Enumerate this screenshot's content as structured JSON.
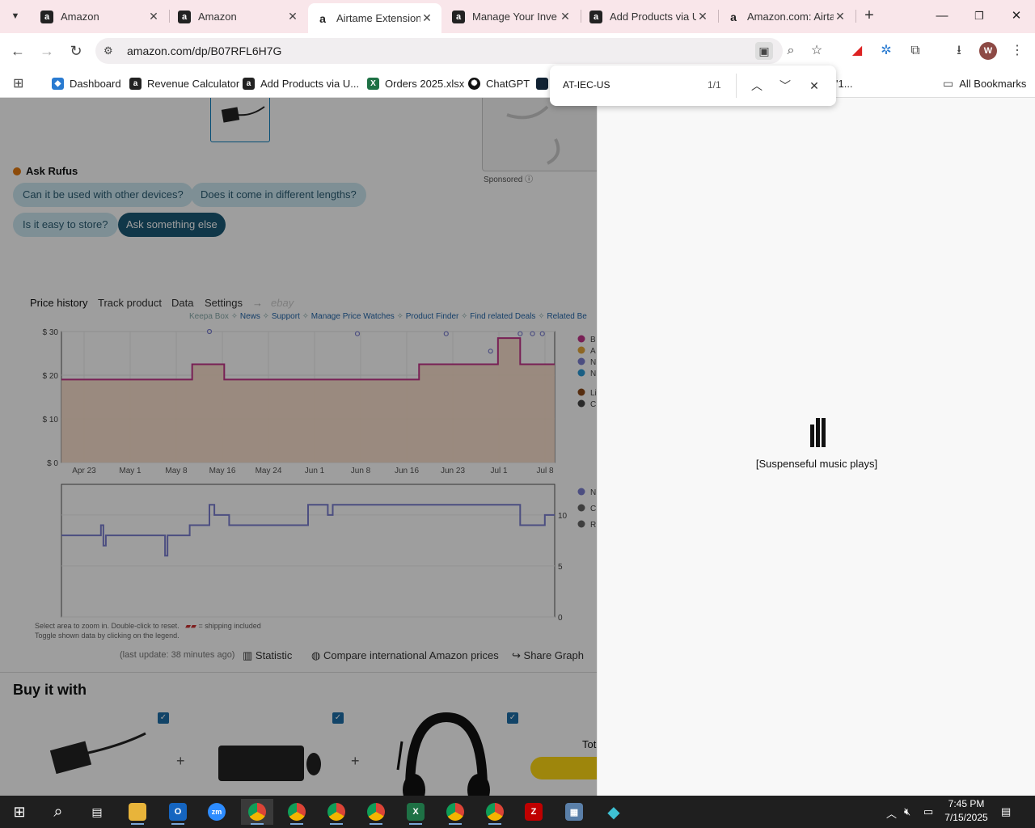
{
  "tabs": [
    {
      "title": "Amazon",
      "favicon": "a"
    },
    {
      "title": "Amazon",
      "favicon": "a"
    },
    {
      "title": "Airtame Extension",
      "favicon": "a"
    },
    {
      "title": "Manage Your Inve",
      "favicon": "a"
    },
    {
      "title": "Add Products via U",
      "favicon": "a"
    },
    {
      "title": "Amazon.com: Airta",
      "favicon": "a"
    }
  ],
  "omnibox": {
    "url": "amazon.com/dp/B07RFL6H7G"
  },
  "profile_initial": "W",
  "bookmarks": [
    {
      "label": "Dashboard",
      "color": "#2a7bd1"
    },
    {
      "label": "Revenue Calculator",
      "color": "#222"
    },
    {
      "label": "Add Products via U...",
      "color": "#222"
    },
    {
      "label": "Orders 2025.xlsx",
      "color": "#1e7145"
    },
    {
      "label": "ChatGPT",
      "color": "#111"
    }
  ],
  "bookmark_trailing": "'1...",
  "all_bookmarks": "All Bookmarks",
  "find": {
    "query": "AT-IEC-US",
    "count": "1/1"
  },
  "page": {
    "sponsored": "Sponsored",
    "rufus_title": "Ask Rufus",
    "rufus_chips": [
      "Can it be used with other devices?",
      "Does it come in different lengths?",
      "Is it easy to store?",
      "Ask something else"
    ],
    "keepa_tabs": [
      "Price history",
      "Track product",
      "Data",
      "Settings"
    ],
    "keepa_arrow": "→",
    "keepa_ebay": "ebay",
    "keepa_box": "Keepa Box",
    "keepa_links": [
      "News",
      "Support",
      "Manage Price Watches",
      "Product Finder",
      "Find related Deals",
      "Related Be"
    ],
    "note_line1": "Select area to zoom in. Double-click to reset.",
    "note_line1b": "= shipping included",
    "note_line2": "Toggle shown data by clicking on the legend.",
    "last_update": "(last update: 38 minutes ago)",
    "statistic": "Statistic",
    "compare": "Compare international Amazon prices",
    "share": "Share Graph",
    "buy_title": "Buy it with",
    "total_label": "Tot"
  },
  "chart_data": [
    {
      "type": "line",
      "ylabels": [
        "$ 30",
        "$ 20",
        "$ 10",
        "$ 0"
      ],
      "ylim": [
        0,
        30
      ],
      "x": [
        "Apr 23",
        "May 1",
        "May 8",
        "May 16",
        "May 24",
        "Jun 1",
        "Jun 8",
        "Jun 16",
        "Jun 23",
        "Jul 1",
        "Jul 8"
      ],
      "legend_letters": [
        "B",
        "A",
        "N",
        "N",
        "Li",
        "C"
      ],
      "legend_colors": [
        "#c2358a",
        "#e5a63a",
        "#7b7fd1",
        "#2b9ad6",
        "#8b4a1a",
        "#444"
      ],
      "series": [
        {
          "name": "",
          "color": "#c2358a",
          "step": [
            [
              0,
              19
            ],
            [
              0.265,
              19
            ],
            [
              0.265,
              22.5
            ],
            [
              0.33,
              22.5
            ],
            [
              0.33,
              19
            ],
            [
              0.725,
              19
            ],
            [
              0.725,
              22.5
            ],
            [
              0.885,
              22.5
            ],
            [
              0.885,
              28.5
            ],
            [
              0.93,
              28.5
            ],
            [
              0.93,
              22.5
            ],
            [
              1,
              22.5
            ]
          ]
        },
        {
          "name": "",
          "color": "#7b7fd1",
          "points": [
            [
              0.3,
              30
            ],
            [
              0.6,
              29.5
            ],
            [
              0.78,
              29.5
            ],
            [
              0.87,
              25.5
            ],
            [
              0.93,
              29.5
            ],
            [
              0.955,
              29.5
            ],
            [
              0.975,
              29.5
            ]
          ]
        }
      ]
    },
    {
      "type": "line",
      "ylabels": [
        "10",
        "5",
        "0"
      ],
      "ylim": [
        0,
        13
      ],
      "legend_letters": [
        "N",
        "C",
        "R"
      ],
      "series": [
        {
          "name": "",
          "color": "#7b7fd1",
          "step": [
            [
              0,
              8
            ],
            [
              0.08,
              8
            ],
            [
              0.08,
              9
            ],
            [
              0.085,
              9
            ],
            [
              0.085,
              7
            ],
            [
              0.09,
              7
            ],
            [
              0.09,
              8
            ],
            [
              0.21,
              8
            ],
            [
              0.21,
              6
            ],
            [
              0.215,
              6
            ],
            [
              0.215,
              8
            ],
            [
              0.26,
              8
            ],
            [
              0.26,
              9
            ],
            [
              0.3,
              9
            ],
            [
              0.3,
              11
            ],
            [
              0.31,
              11
            ],
            [
              0.31,
              10
            ],
            [
              0.34,
              10
            ],
            [
              0.34,
              9
            ],
            [
              0.5,
              9
            ],
            [
              0.5,
              11
            ],
            [
              0.54,
              11
            ],
            [
              0.54,
              10
            ],
            [
              0.55,
              10
            ],
            [
              0.55,
              11
            ],
            [
              0.93,
              11
            ],
            [
              0.93,
              9
            ],
            [
              0.98,
              9
            ],
            [
              0.98,
              10
            ],
            [
              1,
              10
            ]
          ]
        }
      ]
    }
  ],
  "buy_items": [
    {
      "name": "power-adapter"
    },
    {
      "name": "keyboard-mouse"
    },
    {
      "name": "headset"
    }
  ],
  "side_panel": {
    "caption": "[Suspenseful music plays]"
  },
  "taskbar": {
    "time": "7:45 PM",
    "date": "7/15/2025"
  }
}
